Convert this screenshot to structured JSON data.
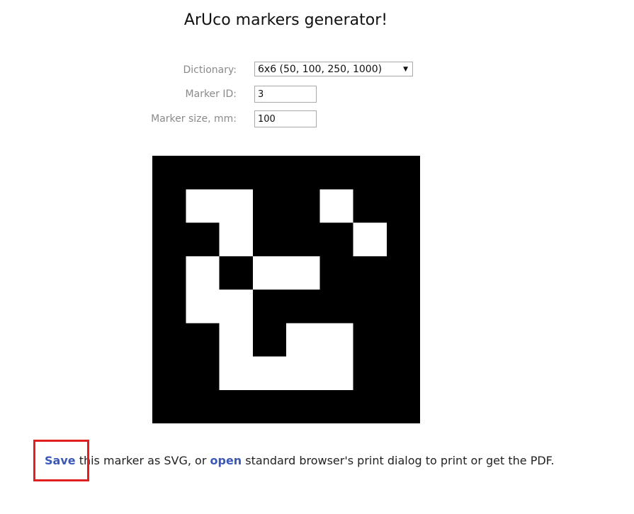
{
  "page": {
    "title": "ArUco markers generator!"
  },
  "form": {
    "dictionary": {
      "label": "Dictionary:",
      "value": "6x6 (50, 100, 250, 1000)"
    },
    "marker_id": {
      "label": "Marker ID:",
      "value": "3"
    },
    "marker_size": {
      "label": "Marker size, mm:",
      "value": "100"
    }
  },
  "marker": {
    "grid_size": 8,
    "colors": {
      "black": "#000000",
      "white": "#ffffff"
    },
    "rows": [
      [
        0,
        0,
        0,
        0,
        0,
        0,
        0,
        0
      ],
      [
        0,
        1,
        1,
        0,
        0,
        1,
        0,
        0
      ],
      [
        0,
        0,
        1,
        0,
        0,
        0,
        1,
        0
      ],
      [
        0,
        1,
        0,
        1,
        1,
        0,
        0,
        0
      ],
      [
        0,
        1,
        1,
        0,
        0,
        0,
        0,
        0
      ],
      [
        0,
        0,
        1,
        0,
        1,
        1,
        0,
        0
      ],
      [
        0,
        0,
        1,
        1,
        1,
        1,
        0,
        0
      ],
      [
        0,
        0,
        0,
        0,
        0,
        0,
        0,
        0
      ]
    ]
  },
  "footer": {
    "save_link": "Save",
    "text_middle": " this marker as SVG, or ",
    "open_link": "open",
    "text_end": " standard browser's print dialog to print or get the PDF."
  },
  "annotation": {
    "highlight_color": "#e02020"
  }
}
